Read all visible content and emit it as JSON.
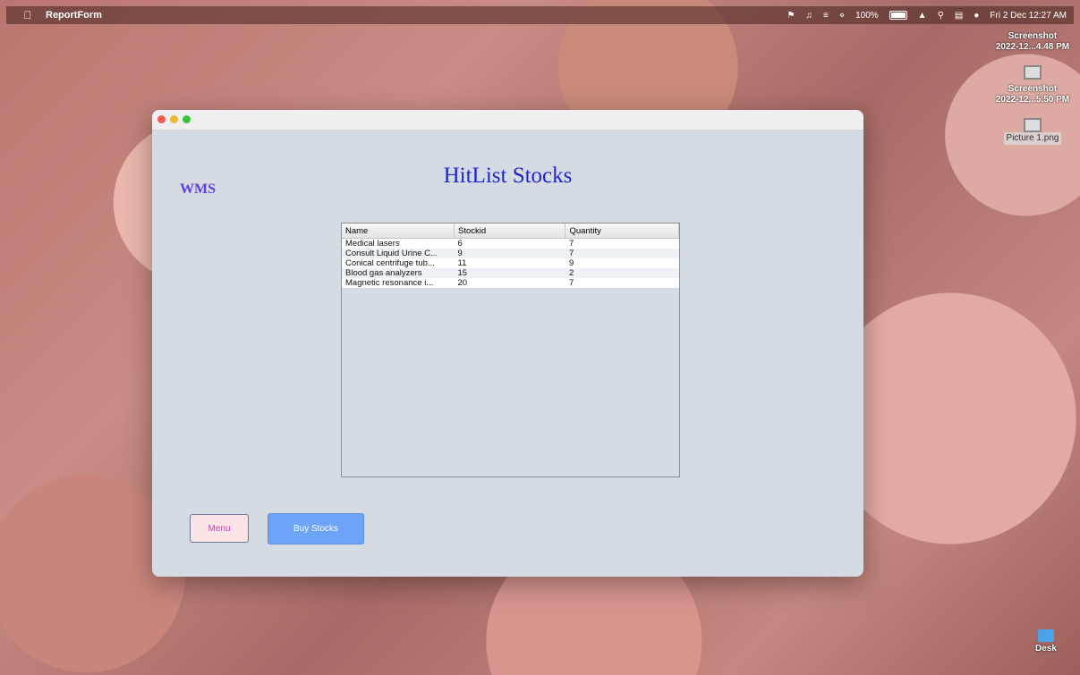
{
  "menubar": {
    "app_name": "ReportForm",
    "battery": "100%",
    "clock": "Fri 2 Dec  12:27 AM"
  },
  "desktop": {
    "items": [
      {
        "label_line1": "Screenshot",
        "label_line2": "2022-12...4.48 PM"
      },
      {
        "label_line1": "Screenshot",
        "label_line2": "2022-12...5.50 PM"
      },
      {
        "label_line1": "Picture 1.png",
        "label_line2": ""
      }
    ],
    "desk_label": "Desk"
  },
  "window": {
    "brand": "WMS",
    "heading": "HitList Stocks",
    "table": {
      "columns": [
        "Name",
        "Stockid",
        "Quantity"
      ],
      "rows": [
        [
          "Medical lasers",
          "6",
          "7"
        ],
        [
          "Consult Liquid Urine C...",
          "9",
          "7"
        ],
        [
          "Conical centrifuge tub...",
          "11",
          "9"
        ],
        [
          "Blood gas analyzers",
          "15",
          "2"
        ],
        [
          "Magnetic resonance i...",
          "20",
          "7"
        ]
      ]
    },
    "buttons": {
      "menu": "Menu",
      "buy": "Buy Stocks"
    }
  }
}
